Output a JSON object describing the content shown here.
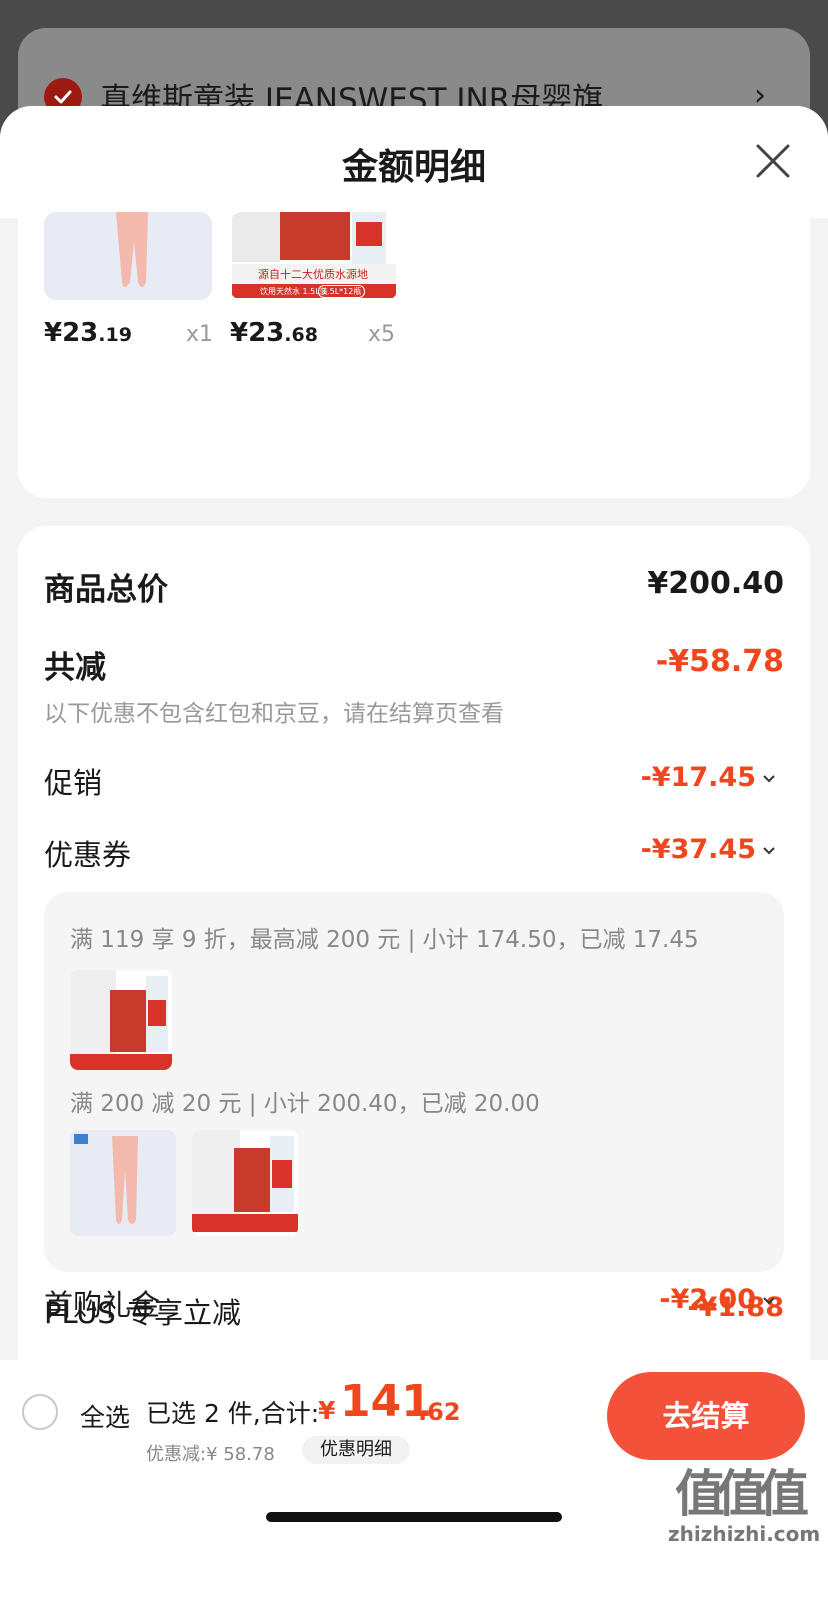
{
  "background": {
    "store_title": "真维斯童装 JEANSWEST JNR母婴旗...",
    "chevron": "›"
  },
  "sheet": {
    "title": "金额明细",
    "close_icon": "close-icon"
  },
  "products": [
    {
      "name": "pants",
      "price_int": "¥23",
      "price_dec": ".19",
      "qty": "x1"
    },
    {
      "name": "water",
      "price_int": "¥23",
      "price_dec": ".68",
      "qty": "x5"
    }
  ],
  "product_badges": {
    "water_banner": "源自十二大优质水源地",
    "water_sub": "饮用天然水 1.5L装",
    "water_tag": "1.5L*12瓶"
  },
  "summary": {
    "total_label": "商品总价",
    "total_value": "¥200.40",
    "discount_label": "共减",
    "discount_value": "-¥58.78",
    "discount_note": "以下优惠不包含红包和京豆，请在结算页查看",
    "promo_label": "促销",
    "promo_value": "-¥17.45",
    "coupon_label": "优惠券",
    "coupon_value": "-¥37.45",
    "coupon_rules": [
      "满 119 享 9 折，最高减 200 元 | 小计 174.50，已减 17.45",
      "满 200 减 20 元 | 小计 200.40，已减 20.00"
    ],
    "plus_label": "PLUS 专享立减",
    "plus_value": "-¥1.88",
    "first_label": "首购礼金",
    "first_value": "-¥2.00"
  },
  "bottom": {
    "select_all": "全选",
    "selected": "已选 2 件,合计:",
    "yen": "¥",
    "total_int": "141",
    "total_dec": ".62",
    "discount_text": "优惠减:¥ 58.78",
    "detail_button": "优惠明细",
    "checkout_button": "去结算"
  },
  "watermark": {
    "mark": "值值值",
    "url": "zhizhizhi.com"
  },
  "colors": {
    "accent": "#f0461e",
    "checkout": "#f4513a"
  }
}
